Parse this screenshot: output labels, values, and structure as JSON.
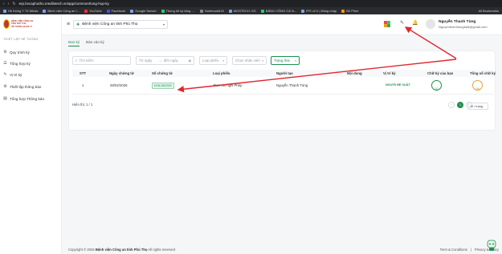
{
  "browser": {
    "url": "erp.bvcaphutho.medilotech.vn/app/common/tong-hop-ky",
    "bookmarks": [
      "Hệ thống Y Tế Minds",
      "Bệnh viện Công an t...",
      "YouTube",
      "Facebook",
      "Google Sensei",
      "Thống kê ký tặng -...",
      "Notebook6.M",
      "MOSTECH..SG",
      "BẢNG CÔNG CÁ N...",
      "IPS v2.0 | Đăng nhập",
      "B2 Phim"
    ],
    "all_bookmarks": "All Bookmarks"
  },
  "sidebar": {
    "logo_line1": "BỆNH VIỆN CÔNG AN TỈNH PHÚ THỌ",
    "logo_line2": "HỆ THỐNG QUẢN LÝ",
    "section_title": "THIẾT LẬP HỆ THỐNG",
    "items": [
      {
        "label": "Quy trình ký"
      },
      {
        "label": "Tổng hợp ký"
      },
      {
        "label": "Vị trí ký"
      },
      {
        "label": "Thiết lập thông báo"
      },
      {
        "label": "Tổng hợp Thông báo"
      }
    ]
  },
  "topbar": {
    "hospital": "Bệnh viện Công an tỉnh Phú Thọ",
    "user_name": "Nguyễn Thanh Tùng",
    "user_email": "Nguyenthanhtung6a8@gmail.com"
  },
  "tabs": [
    {
      "label": "Ban ký",
      "active": true
    },
    {
      "label": "Báo cáo ký",
      "active": false
    }
  ],
  "filters": {
    "search_placeholder": "Tìm kiếm",
    "from_date": "Từ ngày",
    "to_date": "đến ngày",
    "type": "Loại phiếu",
    "staff": "Chọn nhân viên",
    "status": "Trạng thái"
  },
  "table": {
    "columns": [
      "STT",
      "Ngày chứng từ",
      "Số chứng từ",
      "Loại phiếu",
      "Người tạo",
      "Nội dung",
      "Vị trí ký",
      "Chữ ký của bạn",
      "Tổng số chữ ký"
    ],
    "rows": [
      {
        "stt": "1",
        "date": "28/02/2026",
        "doc_no": "DXN-2602003",
        "type": "Đơn xin nghỉ Phép",
        "creator": "Nguyễn Thanh Tùng",
        "content": "",
        "position": "NGƯỜI ĐỀ XUẤT",
        "my_sign": "1/1",
        "total_sign": "1/4"
      }
    ]
  },
  "footer": {
    "count": "Hiển thị: 1 / 1",
    "page": "1",
    "page_size": "10 / trang",
    "copyright_prefix": "Copyright © 2026",
    "copyright_org": "Bệnh viện Công an tỉnh Phú Thọ",
    "copyright_suffix": "All rights reserved",
    "terms": "Term & Conditions",
    "privacy": "Privacy & Policy",
    "separator": "|"
  },
  "colors": {
    "accent": "#1f8f4e",
    "arrow": "#e0262f"
  }
}
